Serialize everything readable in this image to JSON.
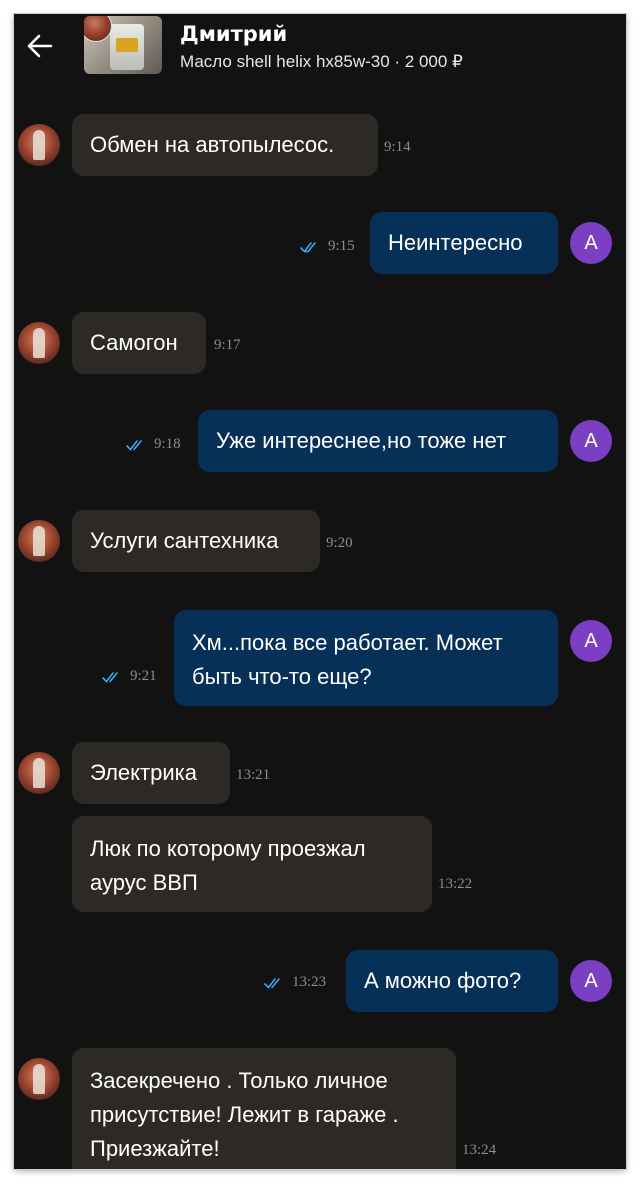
{
  "header": {
    "contact_name": "Дмитрий",
    "ad_title": "Масло shell helix hx85w-30 · 2 000 ₽",
    "back_icon": "arrow-left-icon"
  },
  "colors": {
    "background": "#121212",
    "incoming_bubble": "#2d2a26",
    "outgoing_bubble": "#073058",
    "read_check": "#3aa8f0",
    "user_avatar": "#7a3fc2"
  },
  "user_initial": "А",
  "messages": [
    {
      "direction": "in",
      "text": "Обмен на автопылесос.",
      "time": "9:14"
    },
    {
      "direction": "out",
      "text": "Неинтересно",
      "time": "9:15",
      "status": "read"
    },
    {
      "direction": "in",
      "text": "Самогон",
      "time": "9:17"
    },
    {
      "direction": "out",
      "text": "Уже интереснее,но тоже нет",
      "time": "9:18",
      "status": "read"
    },
    {
      "direction": "in",
      "text": "Услуги сантехника",
      "time": "9:20"
    },
    {
      "direction": "out",
      "text": "Хм...пока все работает. Может\nбыть что-то еще?",
      "time": "9:21",
      "status": "read"
    },
    {
      "direction": "in",
      "text": "Электрика",
      "time": "13:21"
    },
    {
      "direction": "in",
      "text": "Люк по которому проезжал\nаурус ВВП",
      "time": "13:22"
    },
    {
      "direction": "out",
      "text": "А можно фото?",
      "time": "13:23",
      "status": "read"
    },
    {
      "direction": "in",
      "text": "Засекречено . Только личное\nприсутствие! Лежит в гараже .\nПриезжайте!",
      "time": "13:24"
    }
  ]
}
